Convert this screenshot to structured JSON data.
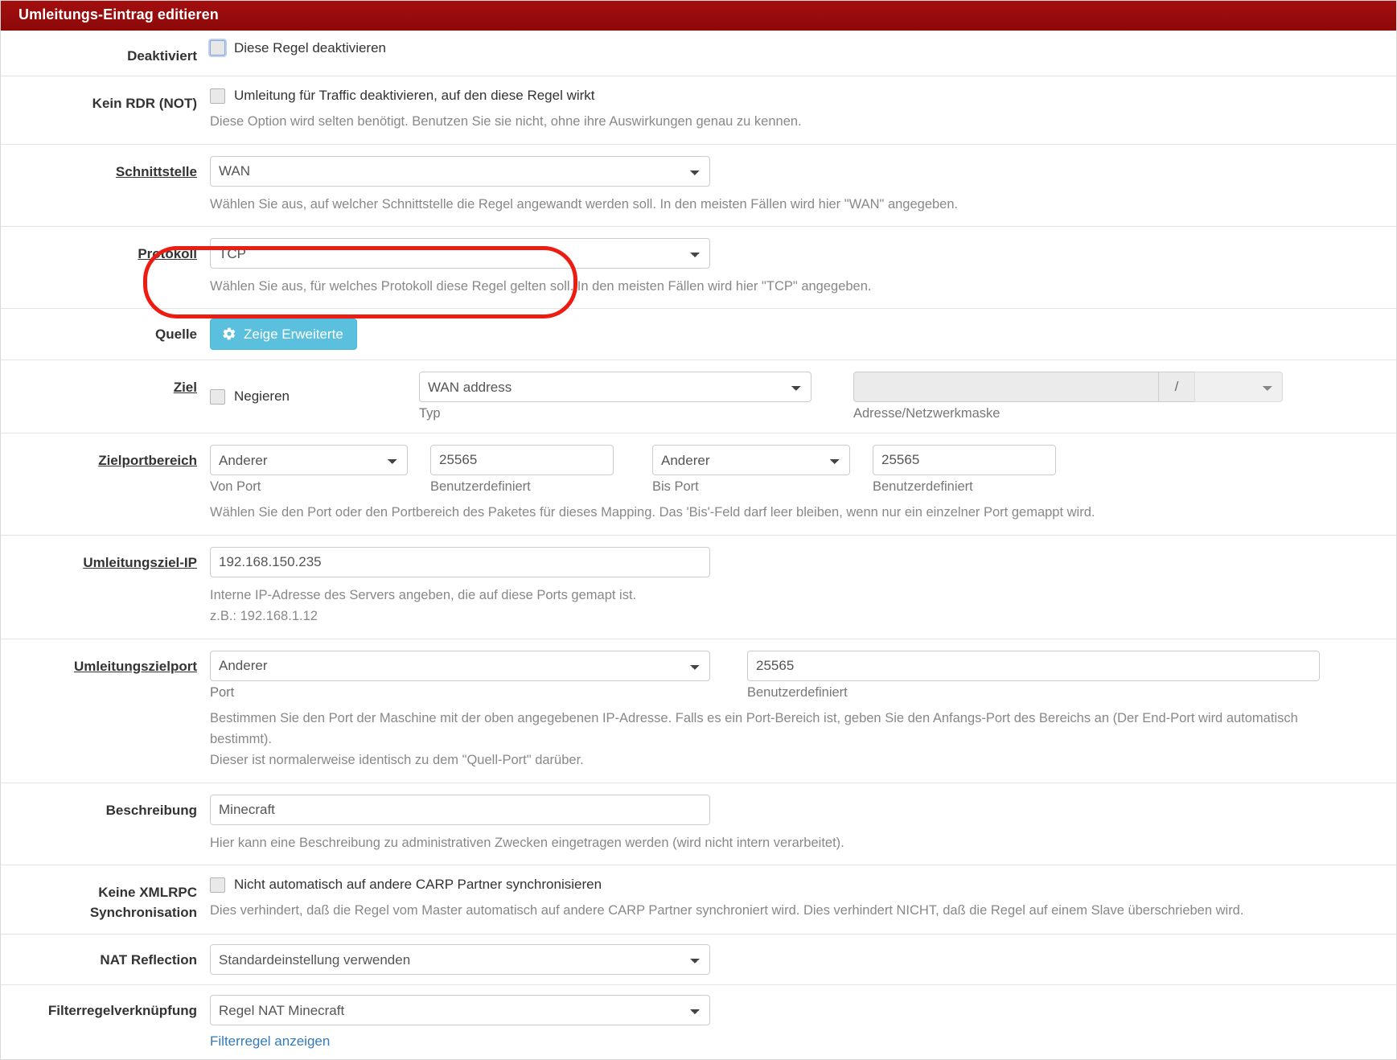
{
  "panel": {
    "title": "Umleitungs-Eintrag editieren"
  },
  "annotation": {
    "shape": "red-ellipse-highlight",
    "color": "#ee1b12",
    "target": "Ziel"
  },
  "rows": {
    "disabled": {
      "label": "Deaktiviert",
      "checkbox_label": "Diese Regel deaktivieren",
      "checked": false
    },
    "no_rdr": {
      "label": "Kein RDR (NOT)",
      "checkbox_label": "Umleitung für Traffic deaktivieren, auf den diese Regel wirkt",
      "checked": false,
      "help": "Diese Option wird selten benötigt. Benutzen Sie sie nicht, ohne ihre Auswirkungen genau zu kennen."
    },
    "interface": {
      "label": "Schnittstelle",
      "value": "WAN",
      "help": "Wählen Sie aus, auf welcher Schnittstelle die Regel angewandt werden soll. In den meisten Fällen wird hier \"WAN\" angegeben."
    },
    "protocol": {
      "label": "Protokoll",
      "value": "TCP",
      "help": "Wählen Sie aus, für welches Protokoll diese Regel gelten soll. In den meisten Fällen wird hier \"TCP\" angegeben."
    },
    "source": {
      "label": "Quelle",
      "button_label": "Zeige Erweiterte",
      "button_icon": "gear-icon"
    },
    "destination": {
      "label": "Ziel",
      "negate_label": "Negieren",
      "negate_checked": false,
      "type_value": "WAN address",
      "type_sublabel": "Typ",
      "address_value": "",
      "address_disabled": true,
      "slash": "/",
      "mask_value": "",
      "mask_disabled": true,
      "address_sublabel": "Adresse/Netzwerkmaske"
    },
    "dest_port_range": {
      "label": "Zielportbereich",
      "from_port_value": "Anderer",
      "from_port_sublabel": "Von Port",
      "from_custom_value": "25565",
      "from_custom_sublabel": "Benutzerdefiniert",
      "to_port_value": "Anderer",
      "to_port_sublabel": "Bis Port",
      "to_custom_value": "25565",
      "to_custom_sublabel": "Benutzerdefiniert",
      "help": "Wählen Sie den Port oder den Portbereich des Paketes für dieses Mapping. Das 'Bis'-Feld darf leer bleiben, wenn nur ein einzelner Port gemappt wird."
    },
    "redirect_target_ip": {
      "label": "Umleitungsziel-IP",
      "value": "192.168.150.235",
      "help_line1": "Interne IP-Adresse des Servers angeben, die auf diese Ports gemapt ist.",
      "help_line2": "z.B.: 192.168.1.12"
    },
    "redirect_target_port": {
      "label": "Umleitungszielport",
      "port_value": "Anderer",
      "port_sublabel": "Port",
      "custom_value": "25565",
      "custom_sublabel": "Benutzerdefiniert",
      "help_line1": "Bestimmen Sie den Port der Maschine mit der oben angegebenen IP-Adresse. Falls es ein Port-Bereich ist, geben Sie den Anfangs-Port des Bereichs an (Der End-Port wird automatisch bestimmt).",
      "help_line2": "Dieser ist normalerweise identisch zu dem \"Quell-Port\" darüber."
    },
    "description": {
      "label": "Beschreibung",
      "value": "Minecraft",
      "help": "Hier kann eine Beschreibung zu administrativen Zwecken eingetragen werden (wird nicht intern verarbeitet)."
    },
    "no_xmlrpc": {
      "label_line1": "Keine XMLRPC",
      "label_line2": "Synchronisation",
      "checkbox_label": "Nicht automatisch auf andere CARP Partner synchronisieren",
      "checked": false,
      "help": "Dies verhindert, daß die Regel vom Master automatisch auf andere CARP Partner synchroniert wird. Dies verhindert NICHT, daß die Regel auf einem Slave überschrieben wird."
    },
    "nat_reflection": {
      "label": "NAT Reflection",
      "value": "Standardeinstellung verwenden"
    },
    "filter_rule_association": {
      "label": "Filterregelverknüpfung",
      "value": "Regel NAT Minecraft",
      "link_label": "Filterregel anzeigen"
    }
  }
}
